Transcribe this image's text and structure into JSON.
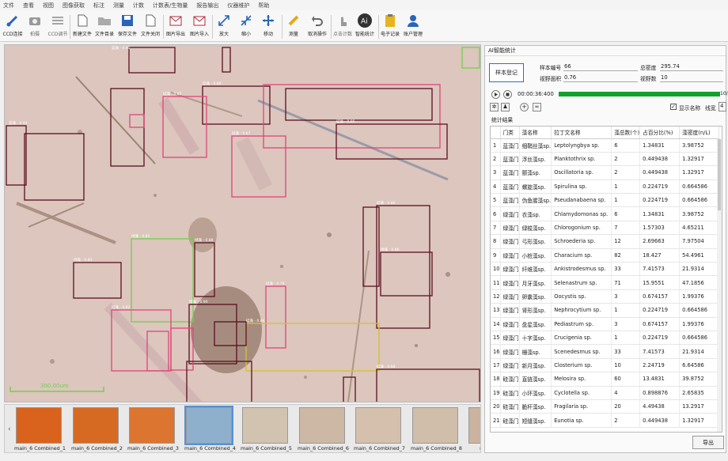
{
  "menu": [
    "文件",
    "查看",
    "视图",
    "图像获取",
    "标注",
    "测量",
    "计数",
    "计数表/生物量",
    "报告输出",
    "仪器维护",
    "帮助"
  ],
  "toolbar": [
    {
      "label": "CCD连接",
      "icon": "ccd-connect-icon"
    },
    {
      "label": "拍摄",
      "icon": "camera-icon"
    },
    {
      "label": "CCD调节",
      "icon": "ccd-adjust-icon"
    },
    {
      "label": "新建文件",
      "icon": "new-file-icon"
    },
    {
      "label": "文件目录",
      "icon": "folder-icon"
    },
    {
      "label": "保存文件",
      "icon": "save-icon"
    },
    {
      "label": "文件关闭",
      "icon": "close-file-icon"
    },
    {
      "label": "图片导出",
      "icon": "image-export-icon"
    },
    {
      "label": "图片导入",
      "icon": "image-import-icon"
    },
    {
      "label": "放大",
      "icon": "zoom-in-icon"
    },
    {
      "label": "缩小",
      "icon": "zoom-out-icon"
    },
    {
      "label": "移动",
      "icon": "move-icon"
    },
    {
      "label": "测量",
      "icon": "ruler-icon"
    },
    {
      "label": "取消操作",
      "icon": "undo-icon"
    },
    {
      "label": "点击计数",
      "icon": "hand-click-icon"
    },
    {
      "label": "智能统计",
      "icon": "ai-icon"
    },
    {
      "label": "电子记录",
      "icon": "clipboard-icon"
    },
    {
      "label": "账户管理",
      "icon": "user-icon"
    }
  ],
  "scale_bar": "300.00um",
  "labels": {
    "row1": [
      "蓝藻 - 0.91",
      "蓝藻 - 0.93",
      "硅藻 - 0.85",
      "硅藻 - 0.86"
    ],
    "row2": [
      "蓝藻 - 0.89",
      "硅藻 - 0.80",
      "绿藻 - 0.88",
      "硅藻 - 0.87"
    ],
    "row3": [
      "绿藻 - 0.83",
      "绿藻 - 0.86",
      "绿藻 - 0.90",
      "硅藻 - 0.82"
    ],
    "row4": [
      "硅藻 - 0.84",
      "硅藻 - 0.88",
      "绿藻 - 0.81",
      "硅藻 - 0.79"
    ]
  },
  "thumbs": [
    {
      "label": "main_6 Combined_1",
      "color": "#d9631c"
    },
    {
      "label": "main_6 Combined_2",
      "color": "#d76a22"
    },
    {
      "label": "main_6 Combined_3",
      "color": "#dc7530"
    },
    {
      "label": "main_6 Combined_4",
      "color": "#8fb0cc"
    },
    {
      "label": "main_6 Combined_5",
      "color": "#d2c2b0"
    },
    {
      "label": "main_6 Combined_6",
      "color": "#cdb8a6"
    },
    {
      "label": "main_6 Combined_7",
      "color": "#d5c0ae"
    },
    {
      "label": "main_6 Combined_8",
      "color": "#d0bdaa"
    },
    {
      "label": "main_6 C",
      "color": "#cbb39f"
    }
  ],
  "panel": {
    "title": "AI智能统计",
    "register_button": "样本登记",
    "sample_no_label": "样本编号",
    "sample_no": "66",
    "field_area_label": "视野面积",
    "field_area": "0.76",
    "total_density_label": "总密度",
    "total_density": "295.74",
    "field_count_label": "视野数",
    "field_count": "10",
    "time": "00:00:36:400",
    "progress_text": "10/",
    "progress": 1.0,
    "show_name_label": "显示名称",
    "show_name_checked": true,
    "line_width_label": "线宽",
    "line_width": "4",
    "stats_title": "统计结果",
    "export_button": "导出"
  },
  "table": {
    "headers": [
      "",
      "门类",
      "藻名称",
      "拉丁文名称",
      "藻总数(个)",
      "占百分比(%)",
      "藻密度(n/L)"
    ],
    "rows": [
      [
        "1",
        "蓝藻门",
        "细鞘丝藻sp.",
        "Leptolyngbya sp.",
        "6",
        "1.34831",
        "3.98752"
      ],
      [
        "2",
        "蓝藻门",
        "浮丝藻sp.",
        "Planktothrix sp.",
        "2",
        "0.449438",
        "1.32917"
      ],
      [
        "3",
        "蓝藻门",
        "颤藻sp.",
        "Oscillatoria sp.",
        "2",
        "0.449438",
        "1.32917"
      ],
      [
        "4",
        "蓝藻门",
        "螺旋藻sp.",
        "Spirulina sp.",
        "1",
        "0.224719",
        "0.664586"
      ],
      [
        "5",
        "蓝藻门",
        "伪鱼腥藻sp.",
        "Pseudanabaena sp.",
        "1",
        "0.224719",
        "0.664586"
      ],
      [
        "6",
        "绿藻门",
        "衣藻sp.",
        "Chlamydomonas sp.",
        "6",
        "1.34831",
        "3.98752"
      ],
      [
        "7",
        "绿藻门",
        "绿梭藻sp.",
        "Chlorogonium sp.",
        "7",
        "1.57303",
        "4.65211"
      ],
      [
        "8",
        "绿藻门",
        "弓形藻sp.",
        "Schroederia sp.",
        "12",
        "2.69663",
        "7.97504"
      ],
      [
        "9",
        "绿藻门",
        "小桩藻sp.",
        "Characium sp.",
        "82",
        "18.427",
        "54.4961"
      ],
      [
        "10",
        "绿藻门",
        "纤维藻sp.",
        "Ankistrodesmus sp.",
        "33",
        "7.41573",
        "21.9314"
      ],
      [
        "11",
        "绿藻门",
        "月牙藻sp.",
        "Selenastrum sp.",
        "71",
        "15.9551",
        "47.1856"
      ],
      [
        "12",
        "绿藻门",
        "卵囊藻sp.",
        "Oocystis sp.",
        "3",
        "0.674157",
        "1.99376"
      ],
      [
        "13",
        "绿藻门",
        "肾形藻sp.",
        "Nephrocytium sp.",
        "1",
        "0.224719",
        "0.664586"
      ],
      [
        "14",
        "绿藻门",
        "盘星藻sp.",
        "Pediastrum sp.",
        "3",
        "0.674157",
        "1.99376"
      ],
      [
        "15",
        "绿藻门",
        "十字藻sp.",
        "Crucigenia sp.",
        "1",
        "0.224719",
        "0.664586"
      ],
      [
        "16",
        "绿藻门",
        "栅藻sp.",
        "Scenedesmus sp.",
        "33",
        "7.41573",
        "21.9314"
      ],
      [
        "17",
        "绿藻门",
        "新月藻sp.",
        "Closterium sp.",
        "10",
        "2.24719",
        "6.64586"
      ],
      [
        "18",
        "硅藻门",
        "直链藻sp.",
        "Melosira sp.",
        "60",
        "13.4831",
        "39.8752"
      ],
      [
        "19",
        "硅藻门",
        "小环藻sp.",
        "Cyclotella sp.",
        "4",
        "0.898876",
        "2.65835"
      ],
      [
        "20",
        "硅藻门",
        "脆杆藻sp.",
        "Fragilaria sp.",
        "20",
        "4.49438",
        "13.2917"
      ],
      [
        "21",
        "硅藻门",
        "短缝藻sp.",
        "Eunotia sp.",
        "2",
        "0.449438",
        "1.32917"
      ]
    ]
  },
  "colors": {
    "box_dark": "#5a0f1e",
    "box_pink": "#e0457a",
    "box_green": "#6ed24a",
    "box_yellow": "#d4c42a",
    "progress": "#13a12c"
  }
}
